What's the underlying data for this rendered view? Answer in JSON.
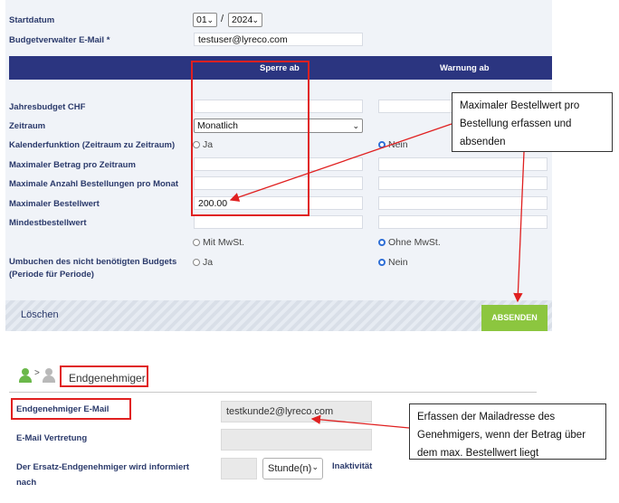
{
  "form": {
    "startdatum_label": "Startdatum",
    "month_value": "01",
    "year_value": "2024",
    "date_sep": "/",
    "budgetverwalter_label": "Budgetverwalter E-Mail *",
    "budgetverwalter_value": "testuser@lyreco.com",
    "col_sperre": "Sperre ab",
    "col_warnung": "Warnung ab",
    "jahresbudget_label": "Jahresbudget CHF",
    "zeitraum_label": "Zeitraum",
    "zeitraum_value": "Monatlich",
    "kalender_label": "Kalenderfunktion (Zeitraum zu Zeitraum)",
    "kalender_ja": "Ja",
    "kalender_nein": "Nein",
    "max_betrag_label": "Maximaler Betrag pro Zeitraum",
    "max_anzahl_label": "Maximale Anzahl Bestellungen pro Monat",
    "max_bestellwert_label": "Maximaler Bestellwert",
    "max_bestellwert_value": "200.00",
    "mindest_label": "Mindestbestellwert",
    "mit_mwst": "Mit MwSt.",
    "ohne_mwst": "Ohne MwSt.",
    "umbuchen_label_1": "Umbuchen des nicht benötigten Budgets",
    "umbuchen_label_2": "(Periode für Periode)",
    "umbuchen_ja": "Ja",
    "umbuchen_nein": "Nein",
    "loeschen": "Löschen",
    "absenden": "ABSENDEN"
  },
  "callouts": {
    "bestellwert_1": "Maximaler Bestellwert pro",
    "bestellwert_2": "Bestellung erfassen und",
    "bestellwert_3": "absenden",
    "mail_1": "Erfassen der Mailadresse des",
    "mail_2": "Genehmigers, wenn der Betrag über",
    "mail_3": "dem max. Bestellwert liegt"
  },
  "approver": {
    "breadcrumb_sep": ">",
    "title": "Endgenehmiger",
    "email_label": "Endgenehmiger E-Mail",
    "email_value": "testkunde2@lyreco.com",
    "vertretung_label": "E-Mail Vertretung",
    "ersatz_label_1": "Der Ersatz-Endgenehmiger wird informiert",
    "ersatz_label_2": "nach",
    "unit_value": "Stunde(n)",
    "inaktivitaet": "Inaktivität"
  },
  "colors": {
    "header": "#2b3580",
    "label": "#2b3a6b",
    "accent_green": "#8cc63f",
    "highlight_red": "#e02020",
    "radio_blue": "#2f6fd6"
  }
}
